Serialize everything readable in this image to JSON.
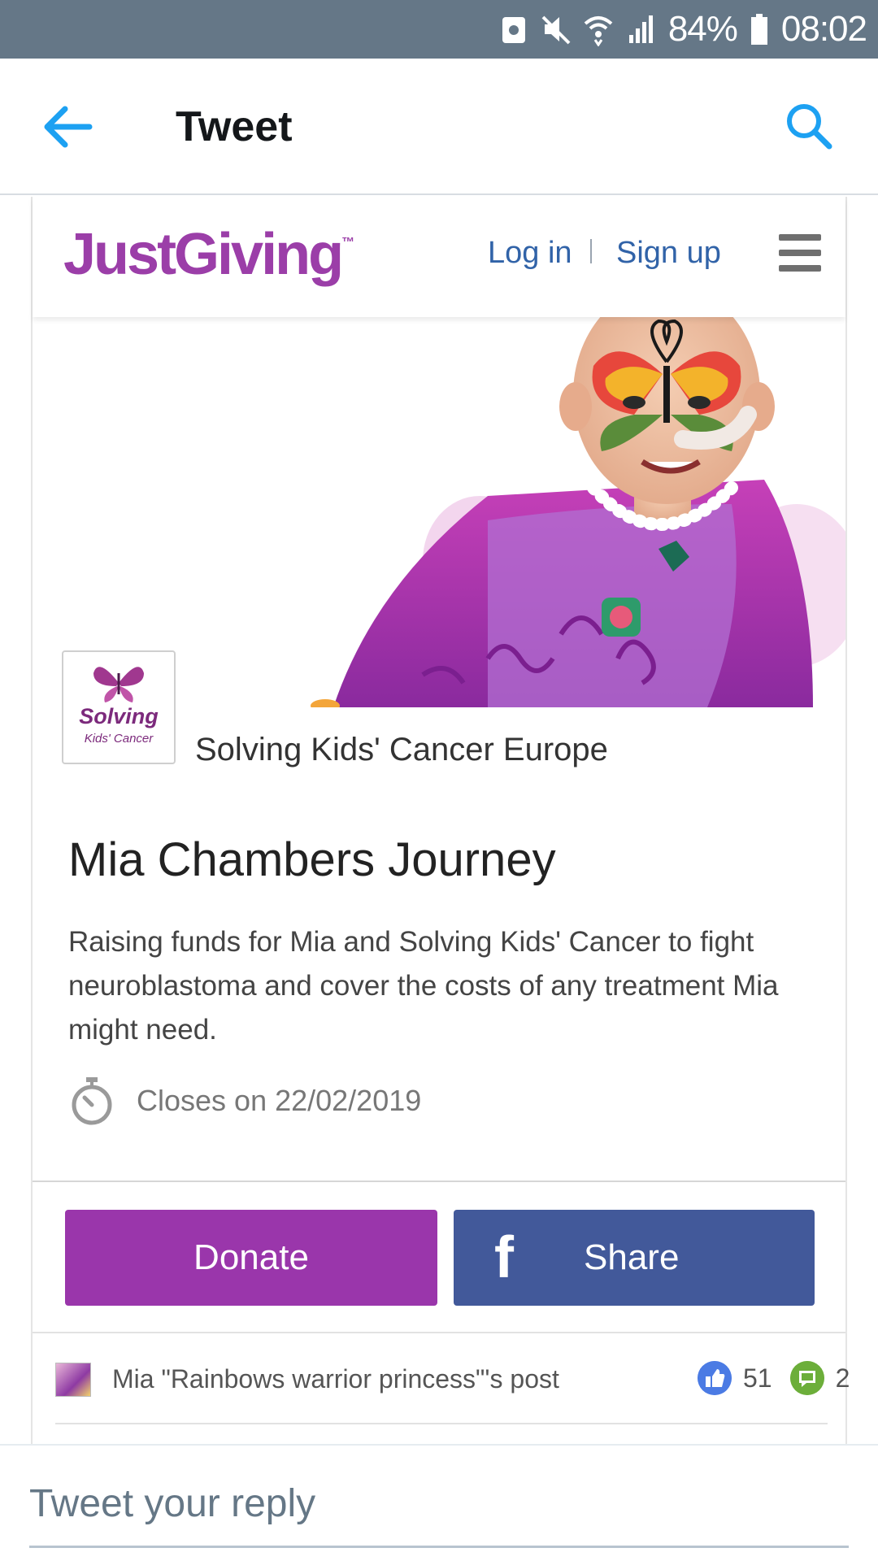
{
  "status_bar": {
    "battery_percent": "84%",
    "time": "08:02"
  },
  "header": {
    "title": "Tweet"
  },
  "justgiving": {
    "logo_text": "JustGiving",
    "logo_tm": "™",
    "login": "Log in",
    "signup": "Sign up"
  },
  "charity": {
    "logo_line1": "Solving",
    "logo_line2": "Kids' Cancer",
    "name": "Solving Kids' Cancer Europe"
  },
  "campaign": {
    "title": "Mia Chambers Journey",
    "description": "Raising funds for Mia and Solving Kids' Cancer to fight neuroblastoma and cover the costs of any treatment Mia might need.",
    "closes": "Closes on 22/02/2019"
  },
  "buttons": {
    "donate": "Donate",
    "share": "Share",
    "fb_glyph": "f"
  },
  "post": {
    "text": "Mia \"Rainbows warrior princess\"'s post",
    "likes": "51",
    "comments": "2"
  },
  "reply": {
    "placeholder": "Tweet your reply"
  },
  "colors": {
    "status_bar": "#657787",
    "twitter_blue": "#1da1f2",
    "justgiving_purple": "#9b3ea8",
    "donate_purple": "#9a36ab",
    "facebook_blue": "#42599a"
  }
}
